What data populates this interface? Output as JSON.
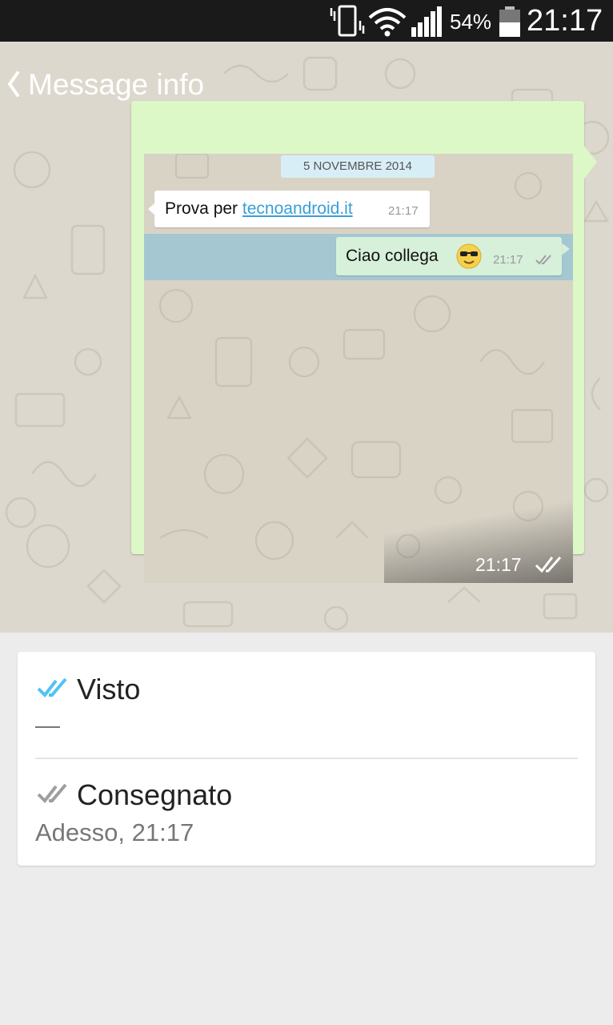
{
  "status_bar": {
    "battery_percent": "54%",
    "time": "21:17",
    "icons": [
      "vibrate-icon",
      "wifi-icon",
      "signal-icon",
      "battery-icon"
    ]
  },
  "header": {
    "title": "Message info",
    "back_icon": "chevron-left-icon"
  },
  "message": {
    "date_chip": "5 NOVEMBRE 2014",
    "incoming": {
      "text": "Prova per ",
      "link": "tecnoandroid.it",
      "time": "21:17"
    },
    "outgoing": {
      "text": "Ciao collega",
      "emoji": "sunglasses-emoji",
      "time": "21:17"
    },
    "time": "21:17"
  },
  "info": {
    "read": {
      "label": "Visto",
      "value": "—",
      "tick_color": "#4fc3f7"
    },
    "delivered": {
      "label": "Consegnato",
      "value": "Adesso, 21:17",
      "tick_color": "#9e9e9e"
    }
  },
  "colors": {
    "bubble": "#dcf8c6",
    "read_ticks": "#4fc3f7",
    "link": "#3a9fd8"
  }
}
